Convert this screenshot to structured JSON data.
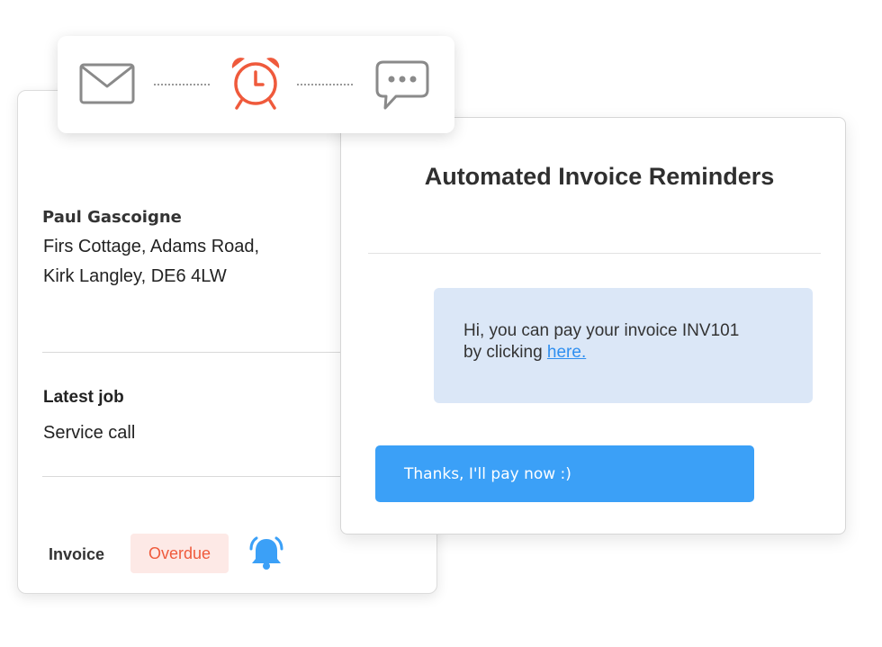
{
  "customer": {
    "name": "Paul Gascoigne",
    "address_line1": "Firs Cottage, Adams Road,",
    "address_line2": "Kirk Langley, DE6 4LW",
    "latest_job_title": "Latest job",
    "latest_job_value": "Service call",
    "invoice_label": "Invoice",
    "invoice_status": "Overdue"
  },
  "icons": {
    "step1": "mail-icon",
    "step2": "alarm-clock-icon",
    "step3": "chat-bubble-icon",
    "status": "bell-icon"
  },
  "reminders": {
    "title": "Automated Invoice Reminders",
    "incoming_line1": "Hi, you can pay your invoice INV101",
    "incoming_line2_prefix": "by clicking ",
    "incoming_link": "here.",
    "reply": "Thanks, I'll pay now :)"
  },
  "colors": {
    "accent_blue": "#3ba0f7",
    "alarm_red": "#ef5a3c",
    "overdue_bg": "#fde9e6",
    "incoming_bg": "#dbe7f7"
  }
}
